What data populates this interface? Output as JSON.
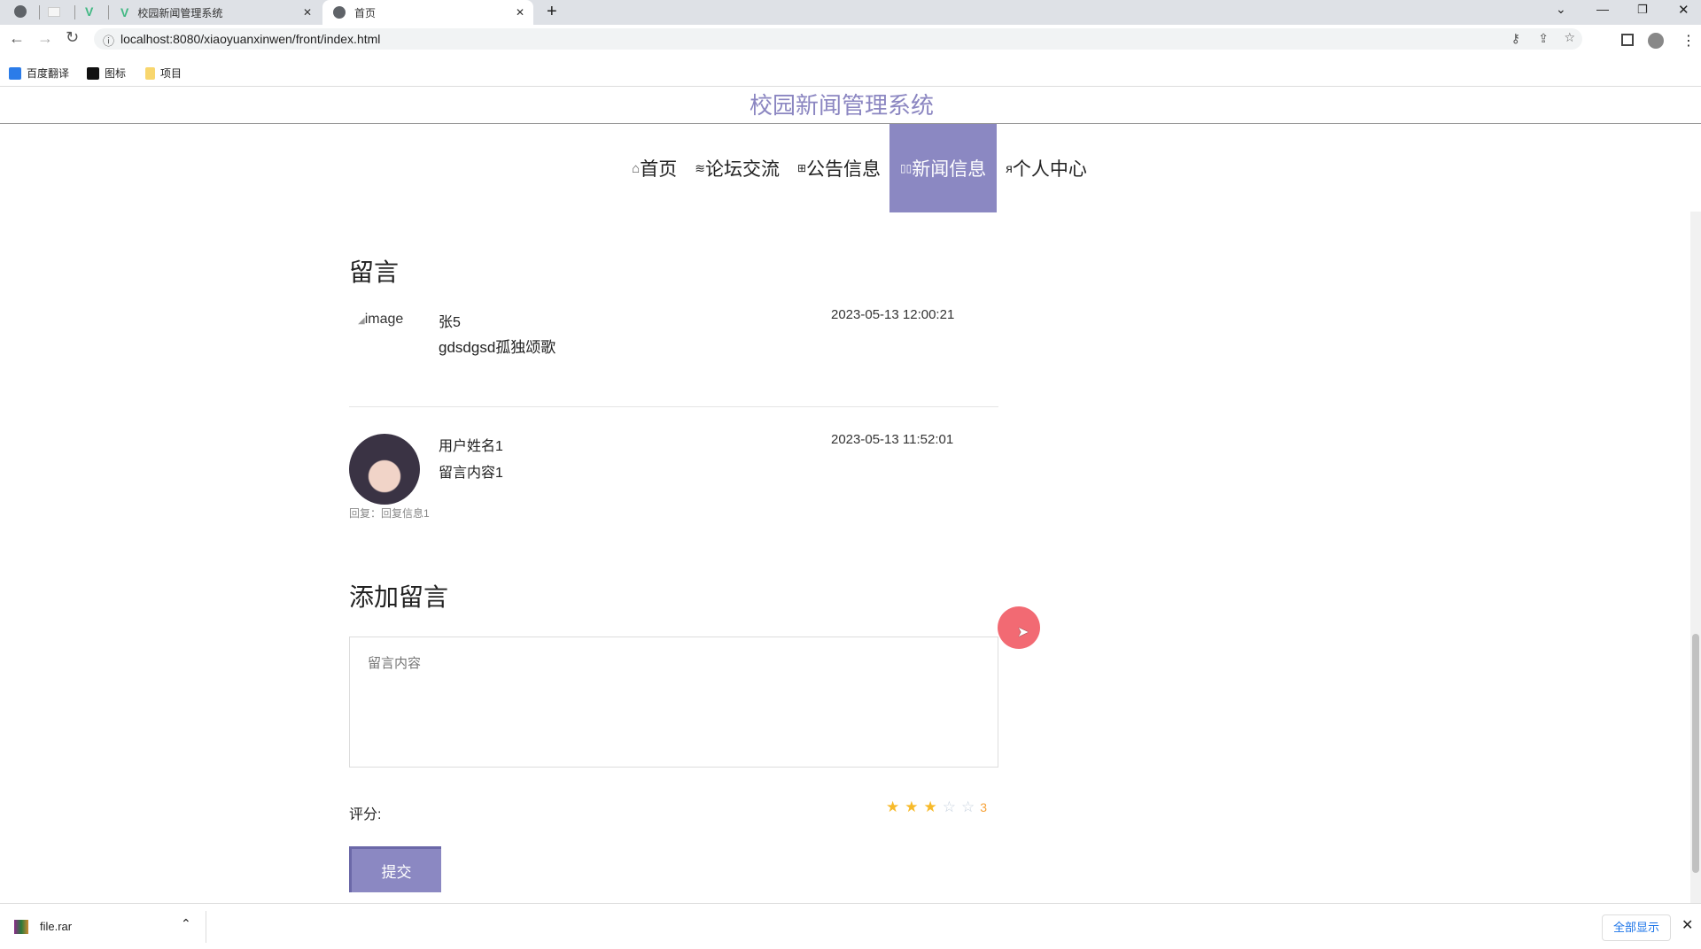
{
  "browser": {
    "tabs": [
      {
        "title": "校园新闻管理系统",
        "active": false
      },
      {
        "title": "首页",
        "active": true
      }
    ],
    "new_tab": "+",
    "url": "localhost:8080/xiaoyuanxinwen/front/index.html",
    "bookmarks": [
      "百度翻译",
      "图标",
      "项目"
    ]
  },
  "site": {
    "title": "校园新闻管理系统"
  },
  "nav": [
    {
      "label": "首页",
      "icon": "home-icon",
      "active": false
    },
    {
      "label": "论坛交流",
      "icon": "layers-icon",
      "active": false
    },
    {
      "label": "公告信息",
      "icon": "gift-icon",
      "active": false
    },
    {
      "label": "新闻信息",
      "icon": "news-icon",
      "active": true
    },
    {
      "label": "个人中心",
      "icon": "user-icon",
      "active": false
    }
  ],
  "comments": {
    "heading": "留言",
    "items": [
      {
        "avatar_alt": "image",
        "name": "张5",
        "content": "gdsdgsd孤独颂歌",
        "time": "2023-05-13 12:00:21",
        "reply": ""
      },
      {
        "name": "用户姓名1",
        "content": "留言内容1",
        "time": "2023-05-13 11:52:01",
        "reply": "回复：回复信息1"
      }
    ]
  },
  "add": {
    "heading": "添加留言",
    "placeholder": "留言内容",
    "rating_label": "评分:",
    "rating": 3,
    "rating_max": 5,
    "rating_text": "3",
    "submit": "提交"
  },
  "download": {
    "file": "file.rar",
    "show_all": "全部显示"
  },
  "colors": {
    "accent": "#8b88c2",
    "star": "#f7ba2a"
  }
}
